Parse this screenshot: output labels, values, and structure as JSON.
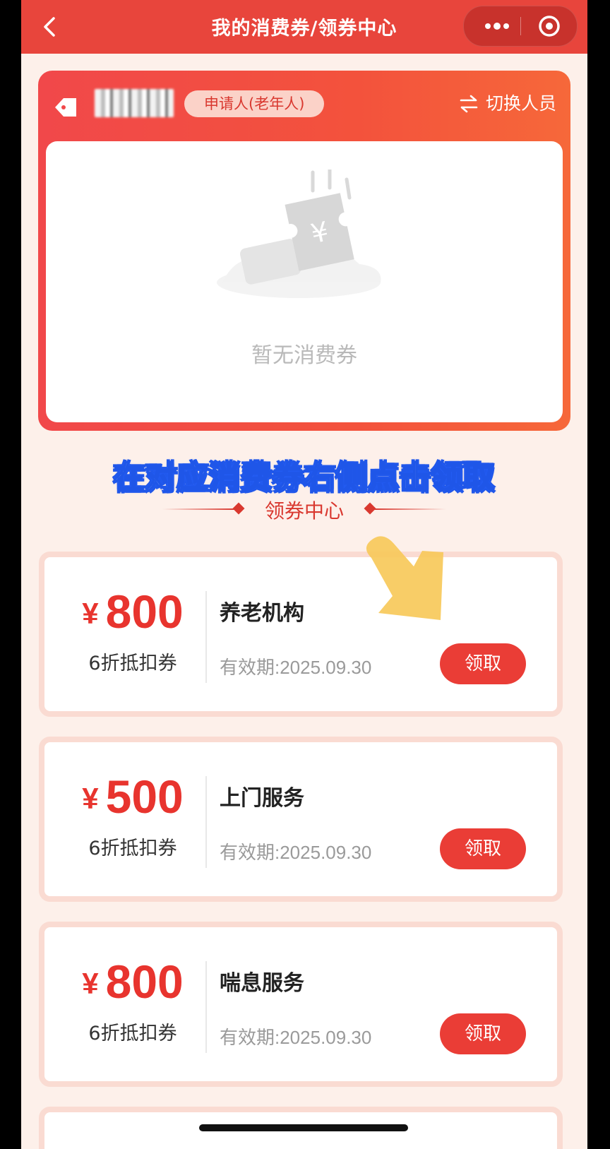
{
  "header": {
    "title": "我的消费券/领券中心"
  },
  "my_coupons": {
    "role_badge": "申请人(老年人)",
    "switch_label": "切换人员",
    "empty_text": "暂无消费券"
  },
  "overlay_caption": "在对应消费券右侧点击领取",
  "section_title": "领券中心",
  "coupons": [
    {
      "currency": "¥",
      "amount": "800",
      "discount": "6折抵扣券",
      "name": "养老机构",
      "validity": "有效期:2025.09.30",
      "button": "领取"
    },
    {
      "currency": "¥",
      "amount": "500",
      "discount": "6折抵扣券",
      "name": "上门服务",
      "validity": "有效期:2025.09.30",
      "button": "领取"
    },
    {
      "currency": "¥",
      "amount": "800",
      "discount": "6折抵扣券",
      "name": "喘息服务",
      "validity": "有效期:2025.09.30",
      "button": "领取"
    }
  ],
  "colors": {
    "primary": "#e8453c",
    "accent": "#ea3d36",
    "page_bg": "#fdf0ea",
    "caption_stroke": "#1f56e8",
    "pointer": "#f7c95a"
  },
  "icons": [
    "back-icon",
    "more-icon",
    "target-icon",
    "tag-icon",
    "switch-icon",
    "empty-coupon-illustration",
    "pointer-arrow-icon"
  ]
}
